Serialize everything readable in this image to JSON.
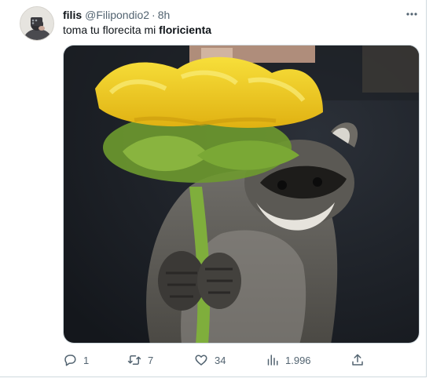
{
  "tweet": {
    "display_name": "filis",
    "handle": "@Filipondio2",
    "separator": "·",
    "time": "8h",
    "text_regular": "toma tu florecita mi ",
    "text_bold": "floricienta",
    "media_icon": "raccoon-holding-sunflower-photo",
    "more_icon": "more-dots-icon"
  },
  "actions": {
    "reply": {
      "icon": "reply-icon",
      "count": "1"
    },
    "retweet": {
      "icon": "retweet-icon",
      "count": "7"
    },
    "like": {
      "icon": "heart-icon",
      "count": "34"
    },
    "views": {
      "icon": "views-icon",
      "count": "1.996"
    },
    "share": {
      "icon": "share-icon"
    }
  },
  "colors": {
    "text": "#0f1419",
    "secondary": "#536471",
    "border": "#cfd9de"
  }
}
